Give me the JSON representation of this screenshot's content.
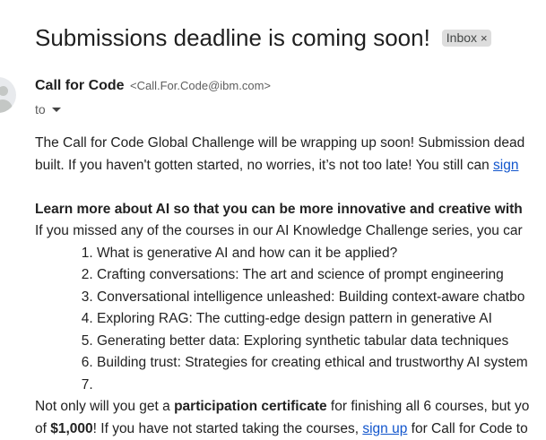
{
  "email": {
    "subject": "Submissions deadline is coming soon!",
    "label": "Inbox",
    "label_remove": "×",
    "sender_name": "Call for Code",
    "sender_email": "<Call.For.Code@ibm.com>",
    "to_label": "to"
  },
  "body": {
    "p1_line1": "The Call for Code Global Challenge will be wrapping up soon! Submission dead",
    "p1_line2_text": "built. If you haven't gotten started, no worries, it’s not too late! You still can ",
    "p1_link": "sign",
    "heading": "Learn more about AI so that you can be more innovative and creative with",
    "intro": "If you missed any of the courses in our AI Knowledge Challenge series, you car",
    "courses": [
      "What is generative AI and how can it be applied?",
      "Crafting conversations: The art and science of prompt engineering",
      "Conversational intelligence unleashed: Building context-aware chatbo",
      "Exploring RAG: The cutting-edge design pattern in generative AI",
      "Generating better data: Exploring synthetic tabular data techniques",
      "Building trust: Strategies for creating ethical and trustworthy AI system",
      ""
    ],
    "p3_line1_pre": "Not only will you get a ",
    "p3_line1_bold": "participation certificate",
    "p3_line1_post": " for finishing all 6 courses, but yo",
    "p3_line2_pre": "of ",
    "p3_line2_bold": "$1,000",
    "p3_line2_mid": "! If you have not started taking the courses, ",
    "p3_line2_link": "sign up",
    "p3_line2_post": " for Call for Code to"
  },
  "colors": {
    "link": "#1155cc",
    "label_chip_bg": "#dddddd"
  }
}
